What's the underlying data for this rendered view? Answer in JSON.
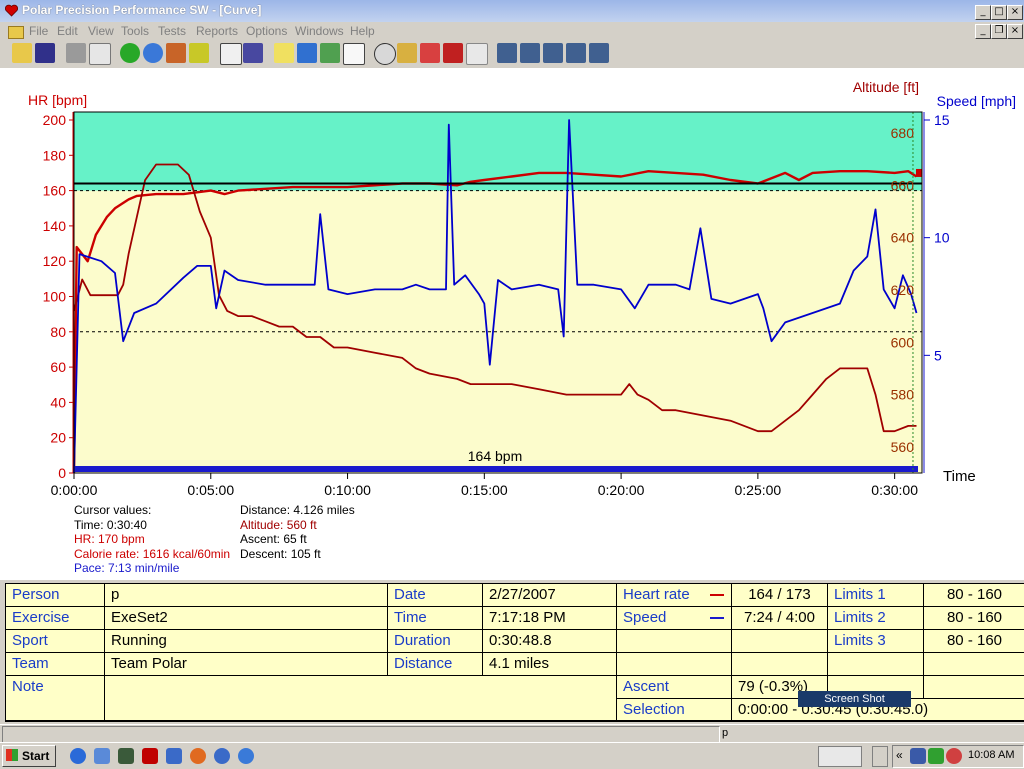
{
  "window": {
    "title": "Polar Precision Performance SW - [Curve]"
  },
  "menu": [
    "File",
    "Edit",
    "View",
    "Tools",
    "Tests",
    "Reports",
    "Options",
    "Windows",
    "Help"
  ],
  "chart_data": {
    "type": "line",
    "title": "",
    "ylabel_left": "HR [bpm]",
    "ylabel_right_1": "Altitude [ft]",
    "ylabel_right_2": "Speed [mph]",
    "xlabel": "Time",
    "hr_axis": {
      "ylim": [
        0,
        200
      ],
      "ticks": [
        0,
        20,
        40,
        60,
        80,
        100,
        120,
        140,
        160,
        180,
        200
      ]
    },
    "altitude_axis": {
      "ylim": [
        550,
        685
      ],
      "ticks": [
        560,
        580,
        600,
        620,
        640,
        660,
        680
      ]
    },
    "speed_axis": {
      "ylim": [
        0,
        15
      ],
      "ticks": [
        5,
        10,
        15
      ]
    },
    "x_ticks": [
      "0:00:00",
      "0:05:00",
      "0:10:00",
      "0:15:00",
      "0:20:00",
      "0:25:00",
      "0:30:00"
    ],
    "limit_lines_bpm": [
      80,
      160
    ],
    "average_hr_line_bpm": 164,
    "average_label": "164 bpm",
    "colors": {
      "hr": "#cc0000",
      "altitude": "#a00000",
      "speed": "#0000cc",
      "zone_high": "#66f2c8",
      "zone_mid": "#fcfccc"
    },
    "series": [
      {
        "name": "HR",
        "axis": "hr",
        "points": [
          [
            0,
            0
          ],
          [
            0.1,
            128
          ],
          [
            0.5,
            120
          ],
          [
            0.8,
            135
          ],
          [
            1.2,
            145
          ],
          [
            1.5,
            150
          ],
          [
            2,
            155
          ],
          [
            2.3,
            157
          ],
          [
            3,
            158
          ],
          [
            4,
            158
          ],
          [
            5,
            160
          ],
          [
            5.5,
            158
          ],
          [
            6,
            160
          ],
          [
            7,
            161
          ],
          [
            8,
            162
          ],
          [
            9,
            162
          ],
          [
            10,
            162
          ],
          [
            11,
            163
          ],
          [
            12,
            164
          ],
          [
            13,
            164
          ],
          [
            14,
            163
          ],
          [
            14.5,
            165
          ],
          [
            15,
            166
          ],
          [
            16,
            168
          ],
          [
            17,
            170
          ],
          [
            18,
            170
          ],
          [
            19,
            169
          ],
          [
            20,
            168
          ],
          [
            21,
            171
          ],
          [
            22,
            170
          ],
          [
            23,
            169
          ],
          [
            24,
            166
          ],
          [
            25,
            164
          ],
          [
            26,
            170
          ],
          [
            26.5,
            166
          ],
          [
            27,
            170
          ],
          [
            28,
            171
          ],
          [
            29,
            171
          ],
          [
            30,
            170
          ],
          [
            30.5,
            171
          ],
          [
            30.8,
            168
          ]
        ]
      },
      {
        "name": "Altitude",
        "axis": "altitude",
        "points": [
          [
            0,
            612
          ],
          [
            0.3,
            624
          ],
          [
            0.6,
            618
          ],
          [
            1,
            618
          ],
          [
            1.6,
            618
          ],
          [
            1.8,
            622
          ],
          [
            2,
            634
          ],
          [
            2.3,
            648
          ],
          [
            2.6,
            662
          ],
          [
            3,
            668
          ],
          [
            3.8,
            668
          ],
          [
            4.2,
            664
          ],
          [
            4.6,
            650
          ],
          [
            5,
            640
          ],
          [
            5.3,
            618
          ],
          [
            5.6,
            612
          ],
          [
            6,
            610
          ],
          [
            6.5,
            610
          ],
          [
            7,
            608
          ],
          [
            7.5,
            606
          ],
          [
            8,
            606
          ],
          [
            8.5,
            602
          ],
          [
            9,
            602
          ],
          [
            9.5,
            598
          ],
          [
            10,
            598
          ],
          [
            11,
            596
          ],
          [
            12,
            594
          ],
          [
            12.5,
            590
          ],
          [
            13,
            588
          ],
          [
            14,
            586
          ],
          [
            14.5,
            584
          ],
          [
            15,
            584
          ],
          [
            16,
            584
          ],
          [
            17,
            582
          ],
          [
            18,
            580
          ],
          [
            19,
            580
          ],
          [
            20,
            580
          ],
          [
            20.3,
            584
          ],
          [
            20.6,
            580
          ],
          [
            21,
            578
          ],
          [
            21.5,
            574
          ],
          [
            22,
            574
          ],
          [
            23,
            572
          ],
          [
            24,
            570
          ],
          [
            25,
            566
          ],
          [
            25.5,
            566
          ],
          [
            26,
            570
          ],
          [
            26.5,
            574
          ],
          [
            27,
            580
          ],
          [
            27.5,
            586
          ],
          [
            28,
            590
          ],
          [
            28.5,
            590
          ],
          [
            29,
            590
          ],
          [
            29.3,
            580
          ],
          [
            29.6,
            566
          ],
          [
            30,
            566
          ],
          [
            30.5,
            568
          ],
          [
            30.8,
            568
          ]
        ]
      },
      {
        "name": "Speed",
        "axis": "speed",
        "points": [
          [
            0,
            0
          ],
          [
            0.2,
            9.3
          ],
          [
            1,
            9.0
          ],
          [
            1.5,
            8.5
          ],
          [
            1.8,
            5.6
          ],
          [
            2.2,
            6.8
          ],
          [
            3,
            7.2
          ],
          [
            4,
            8.3
          ],
          [
            4.5,
            8.8
          ],
          [
            5,
            8.8
          ],
          [
            5.2,
            7.0
          ],
          [
            5.5,
            8.6
          ],
          [
            6,
            8.2
          ],
          [
            7,
            8.0
          ],
          [
            8,
            8.0
          ],
          [
            8.8,
            8.0
          ],
          [
            9,
            11.0
          ],
          [
            9.3,
            7.8
          ],
          [
            10,
            7.6
          ],
          [
            11,
            7.8
          ],
          [
            12,
            7.8
          ],
          [
            12.5,
            8.0
          ],
          [
            13,
            7.8
          ],
          [
            13.6,
            7.8
          ],
          [
            13.7,
            14.8
          ],
          [
            13.9,
            8.0
          ],
          [
            14.3,
            8.4
          ],
          [
            14.8,
            7.6
          ],
          [
            15,
            7.2
          ],
          [
            15.2,
            4.6
          ],
          [
            15.5,
            8.2
          ],
          [
            16,
            7.8
          ],
          [
            17,
            8.0
          ],
          [
            17.7,
            7.8
          ],
          [
            17.9,
            5.8
          ],
          [
            18.1,
            15
          ],
          [
            18.4,
            8.0
          ],
          [
            19,
            8.0
          ],
          [
            20,
            7.8
          ],
          [
            20.5,
            7.0
          ],
          [
            21,
            8.0
          ],
          [
            22,
            8.0
          ],
          [
            22.5,
            7.8
          ],
          [
            22.9,
            10.4
          ],
          [
            23.3,
            7.4
          ],
          [
            24,
            7.2
          ],
          [
            25,
            7.6
          ],
          [
            25.2,
            7.0
          ],
          [
            25.5,
            5.6
          ],
          [
            26,
            6.4
          ],
          [
            27,
            6.8
          ],
          [
            28,
            7.2
          ],
          [
            28.5,
            8.6
          ],
          [
            29,
            9.2
          ],
          [
            29.3,
            11.2
          ],
          [
            29.6,
            7.8
          ],
          [
            30,
            7.0
          ],
          [
            30.3,
            8.4
          ],
          [
            30.6,
            7.6
          ],
          [
            30.8,
            6.8
          ]
        ]
      }
    ]
  },
  "cursor": {
    "heading": "Cursor values:",
    "time": "Time: 0:30:40",
    "hr": "HR: 170 bpm",
    "calorie": "Calorie rate: 1616 kcal/60min",
    "pace": "Pace: 7:13 min/mile",
    "distance": "Distance: 4.126 miles",
    "altitude": "Altitude: 560 ft",
    "ascent": "Ascent: 65 ft",
    "descent": "Descent: 105 ft"
  },
  "info": {
    "person_label": "Person",
    "person": "p",
    "exercise_label": "Exercise",
    "exercise": "ExeSet2",
    "sport_label": "Sport",
    "sport": "Running",
    "team_label": "Team",
    "team": "Team Polar",
    "note_label": "Note",
    "date_label": "Date",
    "date": "2/27/2007",
    "time_label": "Time",
    "time": "7:17:18 PM",
    "duration_label": "Duration",
    "duration": "0:30:48.8",
    "distance_label": "Distance",
    "distance": "4.1 miles",
    "hr_label": "Heart rate",
    "hr_value": "164 / 173",
    "speed_label": "Speed",
    "speed_value": "7:24 / 4:00",
    "ascent_label": "Ascent",
    "ascent_value": "79 (-0.3%)",
    "selection_label": "Selection",
    "selection_value": "0:00:00 - 0:30:45 (0:30:45.0)",
    "limits1_label": "Limits 1",
    "limits1": "80 - 160",
    "limits2_label": "Limits 2",
    "limits2": "80 - 160",
    "limits3_label": "Limits 3",
    "limits3": "80 - 160"
  },
  "tooltip": "Screen Shot",
  "status": {
    "text": "p"
  },
  "taskbar": {
    "start": "Start",
    "clock": "10:08 AM"
  }
}
